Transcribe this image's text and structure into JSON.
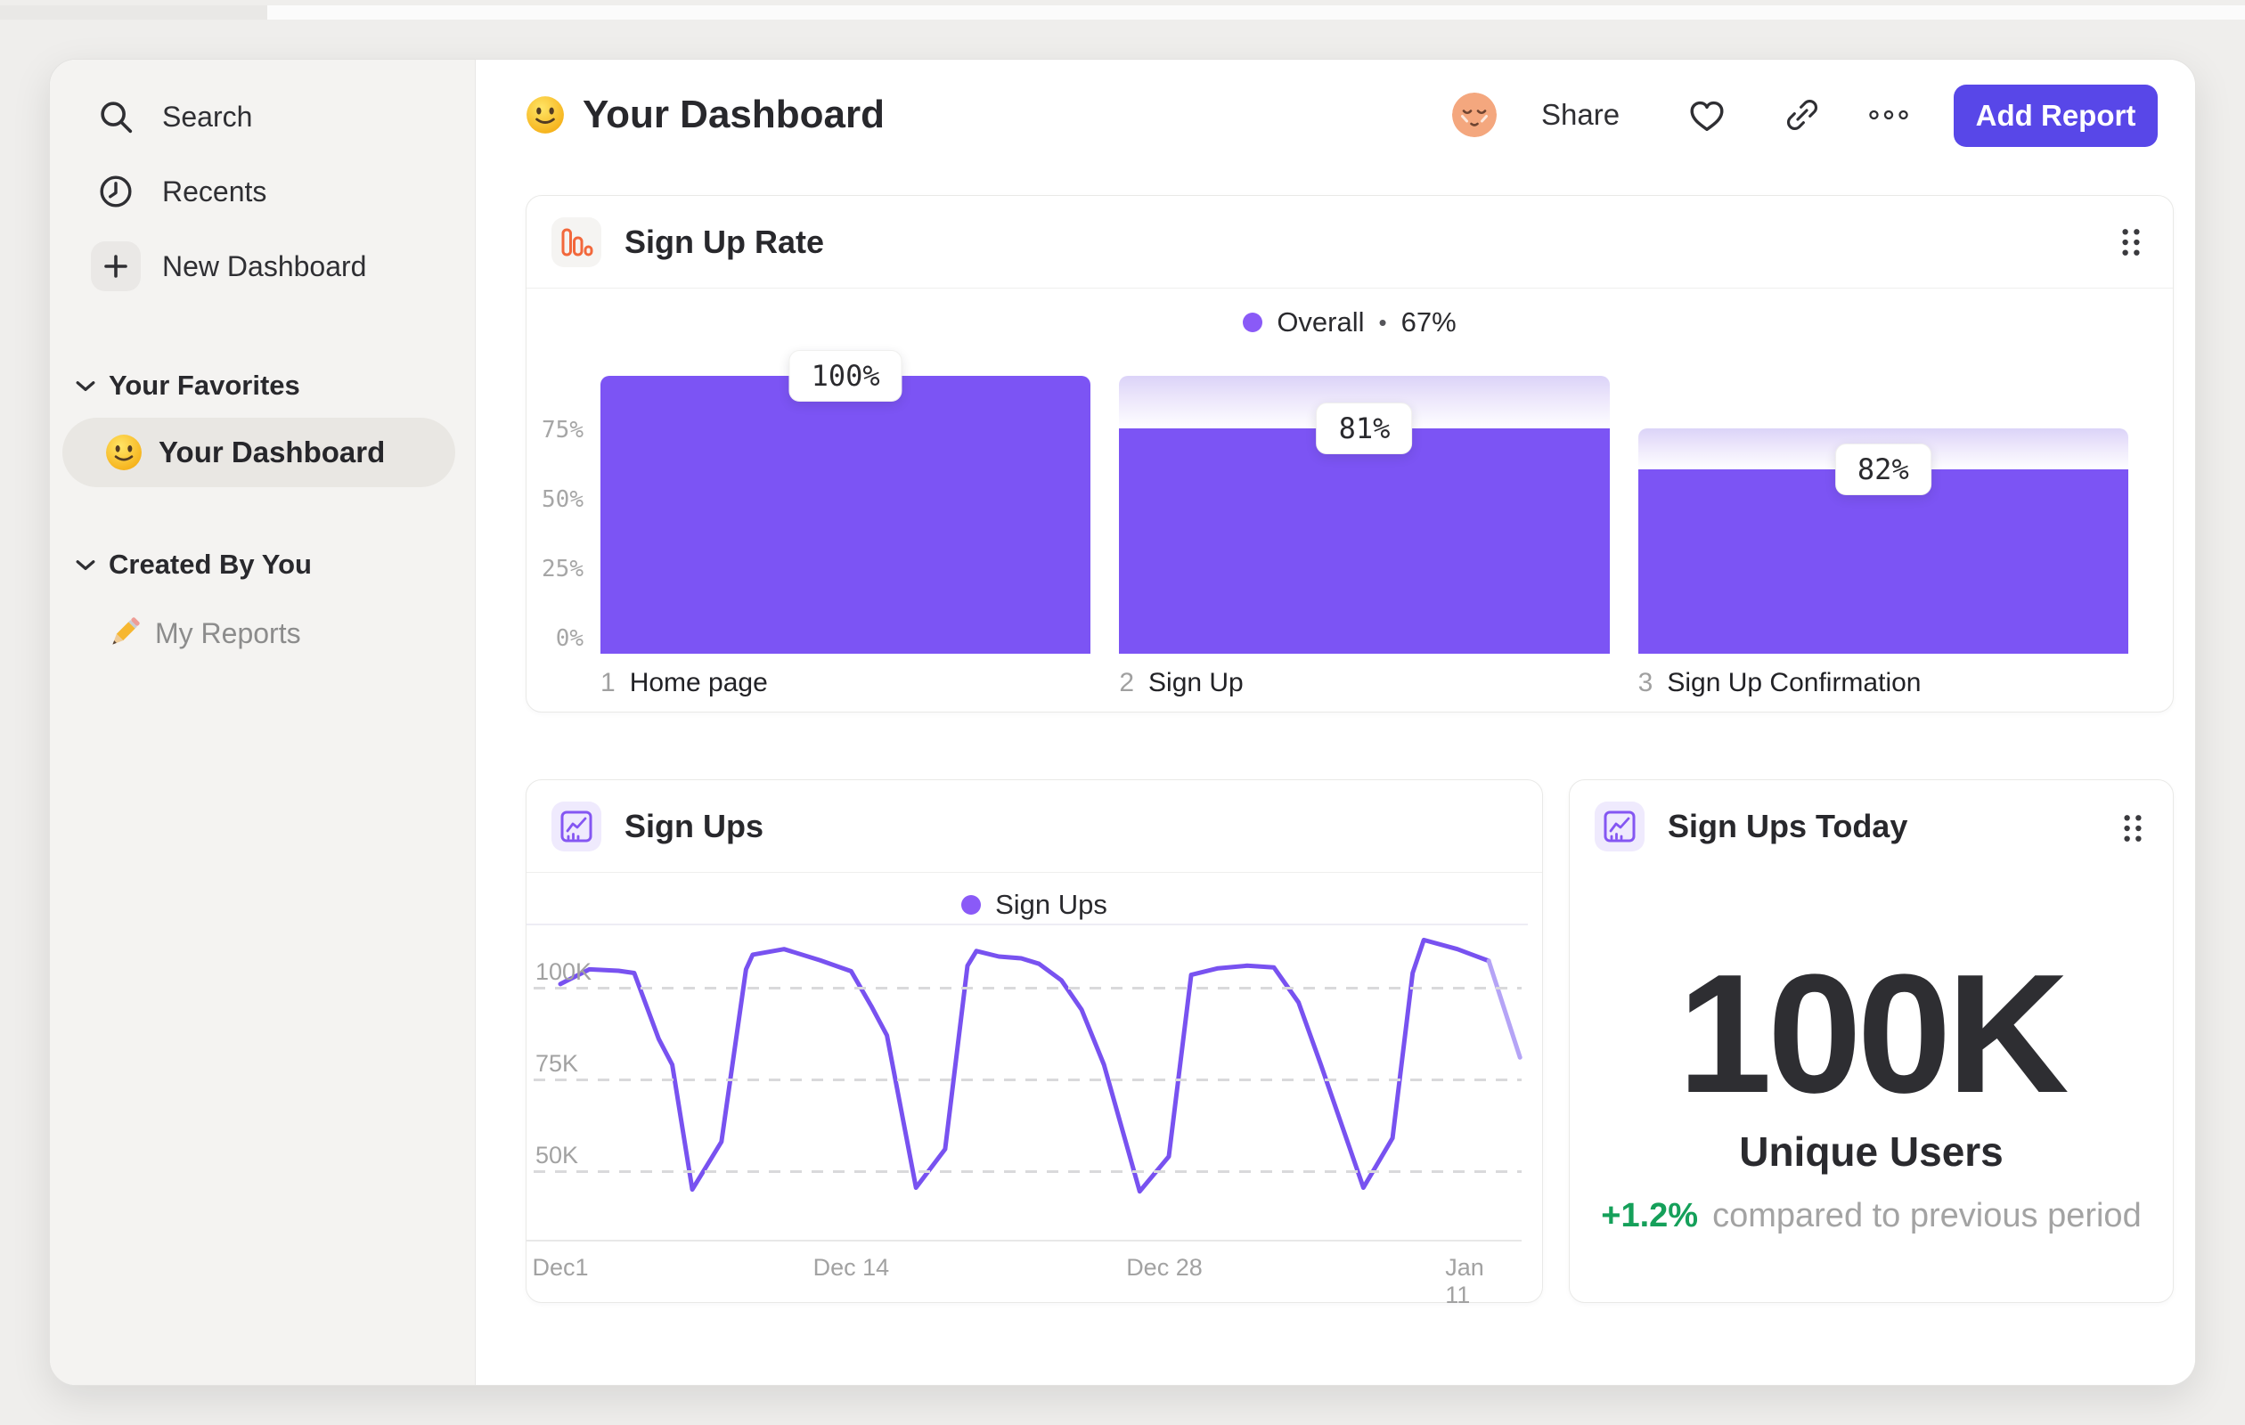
{
  "sidebar": {
    "nav": [
      {
        "label": "Search",
        "icon": "search-icon"
      },
      {
        "label": "Recents",
        "icon": "clock-icon"
      },
      {
        "label": "New Dashboard",
        "icon": "plus-icon"
      }
    ],
    "sections": [
      {
        "label": "Your Favorites",
        "items": [
          {
            "label": "Your Dashboard",
            "icon": "smiley-emoji",
            "active": true
          }
        ]
      },
      {
        "label": "Created By You",
        "items": [
          {
            "label": "My Reports",
            "icon": "pencil-emoji",
            "active": false
          }
        ]
      }
    ]
  },
  "header": {
    "title": "Your Dashboard",
    "share_label": "Share",
    "add_report_label": "Add Report"
  },
  "colors": {
    "accent_bar_purple": "#7C54F4",
    "button_purple": "#5847E8",
    "legend_dot_purple": "#8A5AF7",
    "line_purple": "#7852F0",
    "line_incomplete_purple": "#B5A4F6",
    "icon_orange": "#F2683C",
    "positive_green": "#15A05A"
  },
  "chart_data": [
    {
      "type": "funnel-bar",
      "title": "Sign Up Rate",
      "legend": {
        "series": "Overall",
        "separator": "•",
        "value": "67%"
      },
      "overall_conversion_pct": 67,
      "steps": [
        {
          "index": "1",
          "label": "Home page",
          "step_conversion_pct": 100,
          "cumulative_pct": 100
        },
        {
          "index": "2",
          "label": "Sign Up",
          "step_conversion_pct": 81,
          "cumulative_pct": 81
        },
        {
          "index": "3",
          "label": "Sign Up Confirmation",
          "step_conversion_pct": 82,
          "cumulative_pct": 66.4
        }
      ],
      "value_labels": [
        "100%",
        "81%",
        "82%"
      ],
      "y_ticks": [
        {
          "label": "75%",
          "pct": 75
        },
        {
          "label": "50%",
          "pct": 50
        },
        {
          "label": "25%",
          "pct": 25
        },
        {
          "label": "0%",
          "pct": 0
        }
      ],
      "y_max_pct": 100,
      "grid": false,
      "legend_position": "top-center"
    },
    {
      "type": "line",
      "title": "Sign Ups",
      "legend": {
        "series": "Sign Ups"
      },
      "x_unit": "days from Dec 1",
      "x_ticks": [
        {
          "label": "Dec1",
          "day": 0
        },
        {
          "label": "Dec 14",
          "day": 13
        },
        {
          "label": "Dec 28",
          "day": 27
        },
        {
          "label": "Jan 11",
          "day": 41
        }
      ],
      "y_ticks": [
        {
          "label": "100K",
          "value_k": 100
        },
        {
          "label": "75K",
          "value_k": 75
        },
        {
          "label": "50K",
          "value_k": 50
        }
      ],
      "y_range_k": [
        31,
        117
      ],
      "grid": "dashed-horizontal",
      "legend_position": "top-center",
      "series": [
        {
          "name": "Sign Ups",
          "unit": "K users",
          "points": [
            [
              0,
              101
            ],
            [
              1.3,
              105
            ],
            [
              2.6,
              104.6
            ],
            [
              3.3,
              104
            ],
            [
              4.4,
              86
            ],
            [
              5,
              79
            ],
            [
              5.9,
              45
            ],
            [
              7.2,
              58
            ],
            [
              8.3,
              105
            ],
            [
              8.6,
              109
            ],
            [
              10,
              110.5
            ],
            [
              11.6,
              107.5
            ],
            [
              13,
              104.5
            ],
            [
              13.9,
              95
            ],
            [
              14.6,
              87
            ],
            [
              15.9,
              45.5
            ],
            [
              17.2,
              56
            ],
            [
              18.2,
              106
            ],
            [
              18.6,
              110
            ],
            [
              19.6,
              108.5
            ],
            [
              20.6,
              108
            ],
            [
              21.4,
              106.5
            ],
            [
              22.4,
              102
            ],
            [
              23.3,
              94
            ],
            [
              24.3,
              79
            ],
            [
              25.9,
              44.5
            ],
            [
              27.2,
              54
            ],
            [
              28.2,
              103.5
            ],
            [
              29.4,
              105.3
            ],
            [
              30.7,
              106
            ],
            [
              31.9,
              105.5
            ],
            [
              33,
              96
            ],
            [
              34,
              79
            ],
            [
              35.9,
              45.5
            ],
            [
              37.2,
              59
            ],
            [
              38.1,
              104
            ],
            [
              38.6,
              113
            ],
            [
              40.1,
              110.5
            ],
            [
              41.5,
              107.3
            ]
          ],
          "incomplete_tail_points": [
            [
              41.5,
              107.3
            ],
            [
              42.9,
              81
            ]
          ]
        }
      ]
    },
    {
      "type": "stat",
      "title": "Sign Ups Today",
      "value": "100K",
      "value_label": "Unique Users",
      "delta": "+1.2%",
      "delta_note": "compared to previous period",
      "delta_direction": "up"
    }
  ]
}
